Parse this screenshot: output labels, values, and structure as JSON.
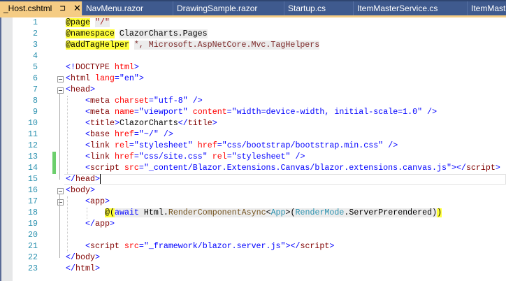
{
  "tabs": [
    {
      "label": "_Host.cshtml",
      "active": true,
      "pin_icon": "pin-icon",
      "close_icon": "close-icon"
    },
    {
      "label": "NavMenu.razor"
    },
    {
      "label": "DrawingSample.razor"
    },
    {
      "label": "Startup.cs"
    },
    {
      "label": "ItemMasterService.cs"
    },
    {
      "label": "ItemMast"
    }
  ],
  "pin_glyph": "⊐",
  "close_glyph": "✕",
  "lines": [
    {
      "n": "1",
      "indent": 0,
      "tokens": [
        [
          "dir",
          "@page"
        ],
        [
          "txt",
          " "
        ],
        [
          "str",
          "\"/\""
        ]
      ]
    },
    {
      "n": "2",
      "indent": 0,
      "tokens": [
        [
          "dir",
          "@namespace"
        ],
        [
          "txt",
          " "
        ],
        [
          "rz",
          "ClazorCharts.Pages"
        ]
      ]
    },
    {
      "n": "3",
      "indent": 0,
      "tokens": [
        [
          "dir",
          "@addTagHelper"
        ],
        [
          "txt",
          " "
        ],
        [
          "rzs",
          "*, Microsoft.AspNetCore.Mvc.TagHelpers"
        ]
      ]
    },
    {
      "n": "4",
      "indent": 0,
      "tokens": []
    },
    {
      "n": "5",
      "indent": 0,
      "tokens": [
        [
          "br",
          "<!"
        ],
        [
          "tag",
          "DOCTYPE"
        ],
        [
          "txt",
          " "
        ],
        [
          "attr",
          "html"
        ],
        [
          "br",
          ">"
        ]
      ]
    },
    {
      "n": "6",
      "indent": 0,
      "fold": true,
      "tokens": [
        [
          "br",
          "<"
        ],
        [
          "tag",
          "html"
        ],
        [
          "txt",
          " "
        ],
        [
          "attr",
          "lang"
        ],
        [
          "br",
          "="
        ],
        [
          "val",
          "\"en\""
        ],
        [
          "br",
          ">"
        ]
      ]
    },
    {
      "n": "7",
      "indent": 0,
      "fold": true,
      "tokens": [
        [
          "br",
          "<"
        ],
        [
          "tag",
          "head"
        ],
        [
          "br",
          ">"
        ]
      ]
    },
    {
      "n": "8",
      "indent": 1,
      "tokens": [
        [
          "br",
          "<"
        ],
        [
          "tag",
          "meta"
        ],
        [
          "txt",
          " "
        ],
        [
          "attr",
          "charset"
        ],
        [
          "br",
          "="
        ],
        [
          "val",
          "\"utf-8\""
        ],
        [
          "txt",
          " "
        ],
        [
          "br",
          "/>"
        ]
      ]
    },
    {
      "n": "9",
      "indent": 1,
      "tokens": [
        [
          "br",
          "<"
        ],
        [
          "tag",
          "meta"
        ],
        [
          "txt",
          " "
        ],
        [
          "attr",
          "name"
        ],
        [
          "br",
          "="
        ],
        [
          "val",
          "\"viewport\""
        ],
        [
          "txt",
          " "
        ],
        [
          "attr",
          "content"
        ],
        [
          "br",
          "="
        ],
        [
          "val",
          "\"width=device-width, initial-scale=1.0\""
        ],
        [
          "txt",
          " "
        ],
        [
          "br",
          "/>"
        ]
      ]
    },
    {
      "n": "10",
      "indent": 1,
      "tokens": [
        [
          "br",
          "<"
        ],
        [
          "tag",
          "title"
        ],
        [
          "br",
          ">"
        ],
        [
          "txt",
          "ClazorCharts"
        ],
        [
          "br",
          "</"
        ],
        [
          "tag",
          "title"
        ],
        [
          "br",
          ">"
        ]
      ]
    },
    {
      "n": "11",
      "indent": 1,
      "tokens": [
        [
          "br",
          "<"
        ],
        [
          "tag",
          "base"
        ],
        [
          "txt",
          " "
        ],
        [
          "attr",
          "href"
        ],
        [
          "br",
          "="
        ],
        [
          "val",
          "\"~/\""
        ],
        [
          "txt",
          " "
        ],
        [
          "br",
          "/>"
        ]
      ]
    },
    {
      "n": "12",
      "indent": 1,
      "tokens": [
        [
          "br",
          "<"
        ],
        [
          "tag",
          "link"
        ],
        [
          "txt",
          " "
        ],
        [
          "attr",
          "rel"
        ],
        [
          "br",
          "="
        ],
        [
          "val",
          "\"stylesheet\""
        ],
        [
          "txt",
          " "
        ],
        [
          "attr",
          "href"
        ],
        [
          "br",
          "="
        ],
        [
          "val",
          "\"css/bootstrap/bootstrap.min.css\""
        ],
        [
          "txt",
          " "
        ],
        [
          "br",
          "/>"
        ]
      ]
    },
    {
      "n": "13",
      "indent": 1,
      "changed": true,
      "tokens": [
        [
          "br",
          "<"
        ],
        [
          "tag",
          "link"
        ],
        [
          "txt",
          " "
        ],
        [
          "attr",
          "href"
        ],
        [
          "br",
          "="
        ],
        [
          "val",
          "\"css/site.css\""
        ],
        [
          "txt",
          " "
        ],
        [
          "attr",
          "rel"
        ],
        [
          "br",
          "="
        ],
        [
          "val",
          "\"stylesheet\""
        ],
        [
          "txt",
          " "
        ],
        [
          "br",
          "/>"
        ]
      ]
    },
    {
      "n": "14",
      "indent": 1,
      "changed": true,
      "tokens": [
        [
          "br",
          "<"
        ],
        [
          "tag",
          "script"
        ],
        [
          "txt",
          " "
        ],
        [
          "attr",
          "src"
        ],
        [
          "br",
          "="
        ],
        [
          "val",
          "\"_content/Blazor.Extensions.Canvas/blazor.extensions.canvas.js\""
        ],
        [
          "br",
          "></"
        ],
        [
          "tag",
          "script"
        ],
        [
          "br",
          ">"
        ]
      ]
    },
    {
      "n": "15",
      "indent": 0,
      "current": true,
      "tokens": [
        [
          "br",
          "</"
        ],
        [
          "tag",
          "head"
        ],
        [
          "br",
          ">"
        ]
      ]
    },
    {
      "n": "16",
      "indent": 0,
      "fold": true,
      "tokens": [
        [
          "br",
          "<"
        ],
        [
          "tag",
          "body"
        ],
        [
          "br",
          ">"
        ]
      ]
    },
    {
      "n": "17",
      "indent": 1,
      "fold": true,
      "tokens": [
        [
          "br",
          "<"
        ],
        [
          "tag",
          "app"
        ],
        [
          "br",
          ">"
        ]
      ]
    },
    {
      "n": "18",
      "indent": 2,
      "tokens": [
        [
          "match",
          "@("
        ],
        [
          "kw",
          "await"
        ],
        [
          "rz",
          " Html."
        ],
        [
          "meth",
          "RenderComponentAsync"
        ],
        [
          "rz",
          "<"
        ],
        [
          "type",
          "App"
        ],
        [
          "rz",
          ">("
        ],
        [
          "type",
          "RenderMode"
        ],
        [
          "rz",
          ".ServerPrerendered)"
        ],
        [
          "match",
          ")"
        ]
      ]
    },
    {
      "n": "19",
      "indent": 1,
      "tokens": [
        [
          "br",
          "</"
        ],
        [
          "tag",
          "app"
        ],
        [
          "br",
          ">"
        ]
      ]
    },
    {
      "n": "20",
      "indent": 0,
      "tokens": []
    },
    {
      "n": "21",
      "indent": 1,
      "tokens": [
        [
          "br",
          "<"
        ],
        [
          "tag",
          "script"
        ],
        [
          "txt",
          " "
        ],
        [
          "attr",
          "src"
        ],
        [
          "br",
          "="
        ],
        [
          "val",
          "\"_framework/blazor.server.js\""
        ],
        [
          "br",
          "></"
        ],
        [
          "tag",
          "script"
        ],
        [
          "br",
          ">"
        ]
      ]
    },
    {
      "n": "22",
      "indent": 0,
      "tokens": [
        [
          "br",
          "</"
        ],
        [
          "tag",
          "body"
        ],
        [
          "br",
          ">"
        ]
      ]
    },
    {
      "n": "23",
      "indent": 0,
      "tokens": [
        [
          "br",
          "</"
        ],
        [
          "tag",
          "html"
        ],
        [
          "br",
          ">"
        ]
      ]
    }
  ]
}
